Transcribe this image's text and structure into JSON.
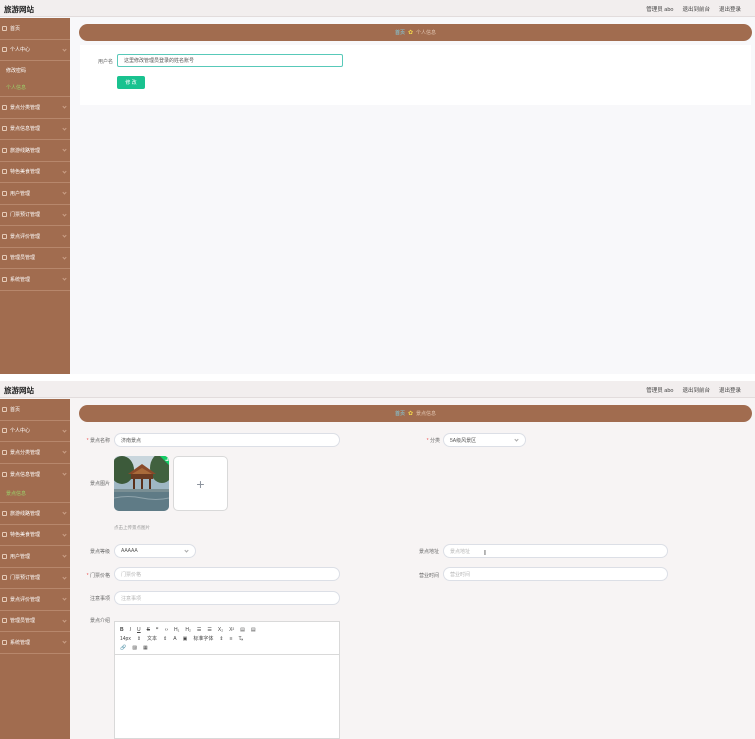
{
  "app": {
    "title": "旅游网站",
    "user_label": "管理员 abo",
    "link_console": "退出到前台",
    "link_logout": "退出登录"
  },
  "panel1": {
    "sidebar": {
      "items": [
        {
          "label": "首页"
        },
        {
          "label": "个人中心"
        },
        {
          "label": "修改密码"
        },
        {
          "label": "个人信息"
        },
        {
          "label": "景点分类管理"
        },
        {
          "label": "景点信息管理"
        },
        {
          "label": "旅游线路管理"
        },
        {
          "label": "特色美食管理"
        },
        {
          "label": "用户管理"
        },
        {
          "label": "门票预订管理"
        },
        {
          "label": "景点评价管理"
        },
        {
          "label": "管理员管理"
        },
        {
          "label": "系统管理"
        }
      ]
    },
    "breadcrumb": {
      "home": "首页",
      "sep": "✿",
      "current": "个人信息"
    },
    "form": {
      "username_label": "用户名",
      "username_value": "这里修改管理员登录的姓名账号",
      "submit_label": "修 改"
    }
  },
  "panel2": {
    "sidebar": {
      "items": [
        {
          "label": "首页"
        },
        {
          "label": "个人中心"
        },
        {
          "label": "景点分类管理"
        },
        {
          "label": "景点信息管理"
        },
        {
          "label": "景点信息"
        },
        {
          "label": "旅游线路管理"
        },
        {
          "label": "特色美食管理"
        },
        {
          "label": "用户管理"
        },
        {
          "label": "门票预订管理"
        },
        {
          "label": "景点评价管理"
        },
        {
          "label": "管理员管理"
        },
        {
          "label": "系统管理"
        }
      ]
    },
    "breadcrumb": {
      "home": "首页",
      "sep": "✿",
      "current": "景点信息"
    },
    "form": {
      "name_label": "景点名称",
      "name_value": "济南景点",
      "category_label": "分类",
      "category_value": "5A级风景区",
      "image_label": "景点图片",
      "image_hint": "点击上传景点图片",
      "upload_plus": "+",
      "level_label": "景点等级",
      "level_value": "AAAAA",
      "address_label": "景点地址",
      "address_placeholder": "景点地址",
      "ticket_label": "门票价格",
      "ticket_placeholder": "门票价格",
      "hours_label": "营业时间",
      "hours_placeholder": "营业时间",
      "notes_label": "注意事项",
      "notes_placeholder": "注意事项",
      "intro_label": "景点介绍",
      "editor_toolbar": {
        "row1": [
          "B",
          "I",
          "U",
          "S",
          "❞",
          "‹›",
          "H₁",
          "H₂",
          "☰",
          "☰",
          "X₂",
          "X²",
          "▤",
          "▤"
        ],
        "row2": [
          "14px",
          "⇕",
          "文本",
          "⇕",
          "A",
          "▣",
          "标准字体",
          "⇕",
          "≡",
          "T̶ₓ"
        ],
        "row3": [
          "🔗",
          "▨",
          "▦"
        ]
      }
    }
  }
}
